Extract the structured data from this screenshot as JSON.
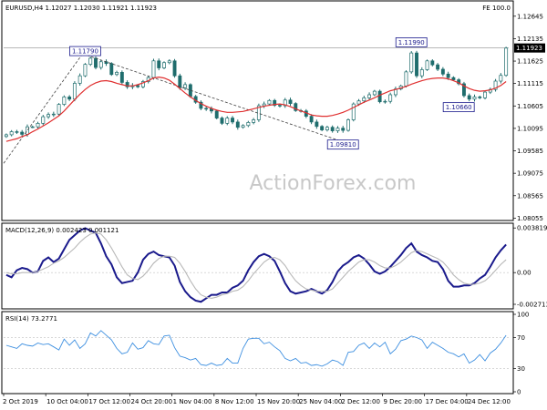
{
  "header": {
    "symbol_ohlc": "EURUSD,H4  1.12027 1.12030 1.11921 1.11923",
    "fe_label": "FE 100.0"
  },
  "watermark": "ActionForex.com",
  "colors": {
    "candle": "#1f6d6d",
    "moving_average": "#e03030",
    "trendline": "#404040",
    "price_line": "#a0a0a0",
    "macd_line": "#1a1a8c",
    "signal_line": "#b8b8b8",
    "rsi_line": "#3d8fe0",
    "price_tag_bg": "#ffffff",
    "price_tag_border": "#1a1a8c",
    "price_tag_text": "#1a1a8c"
  },
  "chart_data": [
    {
      "type": "candlestick",
      "title": "EURUSD,H4  1.12027 1.12030 1.11921 1.11923",
      "y_tick_labels": [
        "1.12645",
        "1.12135",
        "1.11625",
        "1.11115",
        "1.10605",
        "1.10095",
        "1.09585",
        "1.09075",
        "1.08565",
        "1.08055"
      ],
      "ylim": [
        1.08055,
        1.12645
      ],
      "last_price": 1.11923,
      "last_price_label": "1.11923",
      "x_tick_labels": [
        "2 Oct 2019",
        "10 Oct 04:00",
        "17 Oct 12:00",
        "24 Oct 20:00",
        "1 Nov 04:00",
        "8 Nov 12:00",
        "15 Nov 20:00",
        "25 Nov 04:00",
        "2 Dec 12:00",
        "9 Dec 20:00",
        "17 Dec 04:00",
        "24 Dec 12:00"
      ],
      "xlim": [
        0,
        96
      ],
      "close_series": [
        1.0995,
        1.1002,
        1.1001,
        1.0996,
        1.1013,
        1.1013,
        1.1021,
        1.1036,
        1.1041,
        1.1042,
        1.1064,
        1.1081,
        1.1076,
        1.1112,
        1.1129,
        1.1155,
        1.1169,
        1.1148,
        1.1161,
        1.1157,
        1.1132,
        1.1137,
        1.1114,
        1.1104,
        1.1107,
        1.1104,
        1.1116,
        1.1125,
        1.1163,
        1.1147,
        1.1159,
        1.1163,
        1.1129,
        1.1102,
        1.1109,
        1.1082,
        1.1069,
        1.1055,
        1.1054,
        1.1049,
        1.1033,
        1.1021,
        1.1033,
        1.1024,
        1.1012,
        1.1016,
        1.1023,
        1.1029,
        1.1061,
        1.1065,
        1.1073,
        1.1062,
        1.1061,
        1.1074,
        1.1066,
        1.105,
        1.1049,
        1.1037,
        1.1024,
        1.1014,
        1.1006,
        1.1012,
        1.1004,
        1.101,
        1.1005,
        1.1029,
        1.1065,
        1.1072,
        1.1079,
        1.1086,
        1.1094,
        1.107,
        1.1071,
        1.1086,
        1.1099,
        1.1106,
        1.1138,
        1.1181,
        1.1129,
        1.1143,
        1.1163,
        1.1154,
        1.1144,
        1.1133,
        1.1125,
        1.112,
        1.1111,
        1.1084,
        1.1076,
        1.1081,
        1.1079,
        1.1092,
        1.1098,
        1.1117,
        1.113,
        1.1192
      ],
      "moving_average": [
        1.098,
        1.0983,
        1.0986,
        1.0991,
        1.0995,
        1.1002,
        1.1008,
        1.1015,
        1.1022,
        1.103,
        1.1038,
        1.1049,
        1.1062,
        1.1075,
        1.1087,
        1.1098,
        1.1107,
        1.1113,
        1.1117,
        1.1118,
        1.1116,
        1.1112,
        1.1109,
        1.1106,
        1.1106,
        1.1109,
        1.1113,
        1.1118,
        1.1124,
        1.1126,
        1.1124,
        1.1119,
        1.111,
        1.11,
        1.109,
        1.1081,
        1.1073,
        1.1066,
        1.106,
        1.1055,
        1.1051,
        1.1048,
        1.1046,
        1.1046,
        1.1047,
        1.1048,
        1.1051,
        1.1054,
        1.1057,
        1.106,
        1.1062,
        1.1064,
        1.1065,
        1.1063,
        1.1059,
        1.1054,
        1.1049,
        1.1045,
        1.104,
        1.1038,
        1.1037,
        1.1037,
        1.1039,
        1.1042,
        1.1046,
        1.1051,
        1.1057,
        1.1063,
        1.1069,
        1.1074,
        1.1079,
        1.1085,
        1.109,
        1.1095,
        1.1098,
        1.1101,
        1.1105,
        1.111,
        1.1114,
        1.1118,
        1.1121,
        1.1123,
        1.1124,
        1.1124,
        1.1122,
        1.1118,
        1.1113,
        1.1106,
        1.11,
        1.1096,
        1.1094,
        1.1095,
        1.1097,
        1.1101,
        1.1107,
        1.1116
      ],
      "price_tags": [
        {
          "label": "1.11790",
          "index": 15,
          "price": 1.1179,
          "side": "above"
        },
        {
          "label": "1.09810",
          "index": 64,
          "price": 1.0981,
          "side": "below"
        },
        {
          "label": "1.11990",
          "index": 77,
          "price": 1.1199,
          "side": "above"
        },
        {
          "label": "1.10660",
          "index": 86,
          "price": 1.1066,
          "side": "below"
        }
      ],
      "trendlines": [
        {
          "from": [
            0,
            1.093
          ],
          "to": [
            15,
            1.1179
          ]
        },
        {
          "from": [
            15,
            1.1179
          ],
          "to": [
            64,
            1.0981
          ]
        }
      ]
    },
    {
      "type": "line",
      "title": "MACD(12,26,9) 0.002423 0.001121",
      "y_tick_labels": [
        "0.003819",
        "0.00",
        "-0.002713"
      ],
      "ylim": [
        -0.002713,
        0.003819
      ],
      "series": [
        {
          "role": "macd",
          "values": [
            -0.0002,
            -0.0004,
            0.0002,
            0.0004,
            0.0003,
            0.0,
            0.0001,
            0.001,
            0.0013,
            0.0009,
            0.0012,
            0.002,
            0.0028,
            0.0032,
            0.0036,
            0.0038,
            0.0036,
            0.0034,
            0.0025,
            0.0014,
            0.0007,
            -0.0004,
            -0.0009,
            -0.0008,
            -0.0007,
            0.0,
            0.0011,
            0.0016,
            0.0018,
            0.0015,
            0.0014,
            0.0013,
            0.0006,
            -0.0008,
            -0.0016,
            -0.0021,
            -0.0024,
            -0.0025,
            -0.0022,
            -0.0019,
            -0.0019,
            -0.0017,
            -0.0017,
            -0.0013,
            -0.0011,
            -0.0007,
            0.0002,
            0.0009,
            0.0014,
            0.0016,
            0.0014,
            0.001,
            0.0001,
            -0.0009,
            -0.0016,
            -0.0018,
            -0.0017,
            -0.0016,
            -0.0014,
            -0.0016,
            -0.0018,
            -0.0015,
            -0.0008,
            0.0001,
            0.0006,
            0.0009,
            0.0013,
            0.0015,
            0.0012,
            0.0007,
            0.0001,
            -0.0001,
            0.0001,
            0.0005,
            0.001,
            0.0015,
            0.0021,
            0.0025,
            0.0018,
            0.0015,
            0.0013,
            0.001,
            0.0009,
            0.0003,
            -0.0007,
            -0.0012,
            -0.0012,
            -0.0011,
            -0.0011,
            -0.0009,
            -0.0005,
            -0.0002,
            0.0005,
            0.0013,
            0.0019,
            0.0024
          ]
        },
        {
          "role": "signal",
          "values": [
            0.0,
            -0.0001,
            -0.0001,
            0.0,
            0.0,
            0.0,
            0.0001,
            0.0003,
            0.0005,
            0.0008,
            0.001,
            0.0013,
            0.0017,
            0.0021,
            0.0026,
            0.003,
            0.0033,
            0.0034,
            0.0033,
            0.0028,
            0.0021,
            0.0013,
            0.0005,
            -0.0002,
            -0.0005,
            -0.0006,
            -0.0003,
            0.0002,
            0.0008,
            0.0012,
            0.0014,
            0.0014,
            0.0013,
            0.0008,
            0.0001,
            -0.0007,
            -0.0014,
            -0.0019,
            -0.0021,
            -0.0022,
            -0.0021,
            -0.0019,
            -0.0018,
            -0.0016,
            -0.0015,
            -0.0012,
            -0.0007,
            -0.0001,
            0.0004,
            0.0009,
            0.0012,
            0.0013,
            0.0011,
            0.0006,
            -0.0001,
            -0.0007,
            -0.0011,
            -0.0014,
            -0.0015,
            -0.0016,
            -0.0016,
            -0.0016,
            -0.0014,
            -0.0009,
            -0.0004,
            0.0001,
            0.0005,
            0.0009,
            0.0011,
            0.0011,
            0.0009,
            0.0006,
            0.0004,
            0.0004,
            0.0006,
            0.0009,
            0.0013,
            0.0017,
            0.0019,
            0.0018,
            0.0016,
            0.0014,
            0.0012,
            0.0009,
            0.0004,
            -0.0002,
            -0.0006,
            -0.0009,
            -0.001,
            -0.001,
            -0.0009,
            -0.0007,
            -0.0003,
            0.0002,
            0.0007,
            0.0011
          ]
        }
      ]
    },
    {
      "type": "line",
      "title": "RSI(14) 73.2771",
      "y_tick_labels": [
        "100",
        "70",
        "30",
        "0"
      ],
      "ylim": [
        0,
        100
      ],
      "reference_levels": [
        70,
        30
      ],
      "series": [
        {
          "role": "rsi",
          "values": [
            60,
            58,
            56,
            62,
            60,
            59,
            63,
            61,
            62,
            58,
            54,
            68,
            60,
            67,
            56,
            62,
            76,
            72,
            79,
            73,
            67,
            56,
            49,
            51,
            63,
            55,
            57,
            66,
            62,
            61,
            72,
            73,
            57,
            46,
            44,
            41,
            43,
            35,
            34,
            37,
            34,
            35,
            43,
            37,
            37,
            56,
            68,
            69,
            69,
            62,
            64,
            58,
            53,
            43,
            40,
            43,
            37,
            38,
            34,
            35,
            33,
            36,
            41,
            39,
            34,
            51,
            52,
            60,
            63,
            56,
            63,
            58,
            64,
            49,
            55,
            66,
            68,
            72,
            70,
            67,
            56,
            64,
            60,
            56,
            51,
            49,
            45,
            49,
            37,
            41,
            48,
            40,
            50,
            55,
            63,
            73
          ]
        }
      ]
    }
  ]
}
